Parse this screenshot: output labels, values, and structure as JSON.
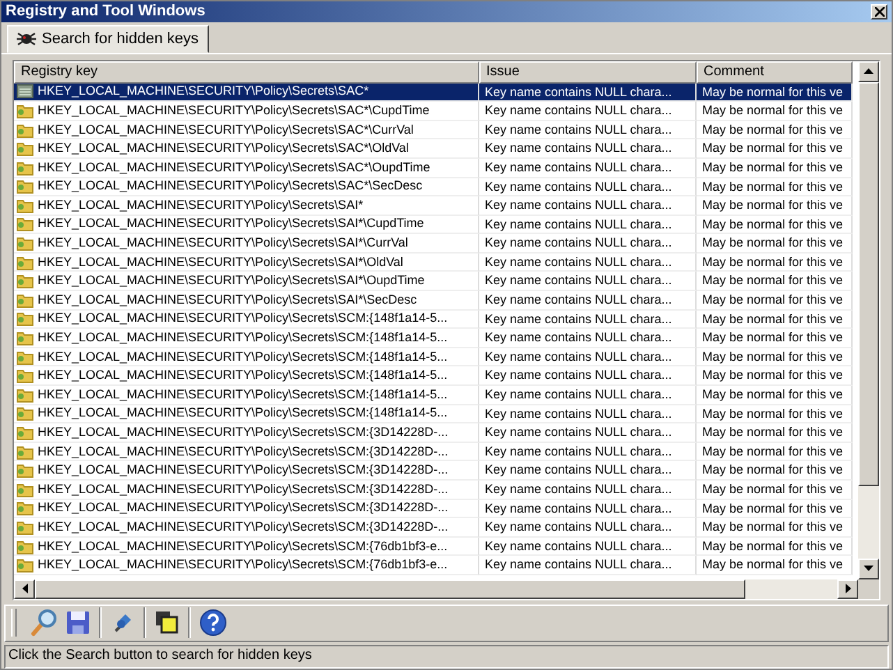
{
  "window": {
    "title": "Registry and Tool Windows"
  },
  "tabs": [
    {
      "label": "Search for hidden keys",
      "selected": true
    }
  ],
  "table": {
    "columns": [
      "Registry key",
      "Issue",
      "Comment"
    ],
    "rows": [
      {
        "key": "HKEY_LOCAL_MACHINE\\SECURITY\\Policy\\Secrets\\SAC*",
        "issue": "Key name contains NULL chara...",
        "comment": "May be normal for this ve",
        "selected": true
      },
      {
        "key": "HKEY_LOCAL_MACHINE\\SECURITY\\Policy\\Secrets\\SAC*\\CupdTime",
        "issue": "Key name contains NULL chara...",
        "comment": "May be normal for this ve",
        "selected": false
      },
      {
        "key": "HKEY_LOCAL_MACHINE\\SECURITY\\Policy\\Secrets\\SAC*\\CurrVal",
        "issue": "Key name contains NULL chara...",
        "comment": "May be normal for this ve",
        "selected": false
      },
      {
        "key": "HKEY_LOCAL_MACHINE\\SECURITY\\Policy\\Secrets\\SAC*\\OldVal",
        "issue": "Key name contains NULL chara...",
        "comment": "May be normal for this ve",
        "selected": false
      },
      {
        "key": "HKEY_LOCAL_MACHINE\\SECURITY\\Policy\\Secrets\\SAC*\\OupdTime",
        "issue": "Key name contains NULL chara...",
        "comment": "May be normal for this ve",
        "selected": false
      },
      {
        "key": "HKEY_LOCAL_MACHINE\\SECURITY\\Policy\\Secrets\\SAC*\\SecDesc",
        "issue": "Key name contains NULL chara...",
        "comment": "May be normal for this ve",
        "selected": false
      },
      {
        "key": "HKEY_LOCAL_MACHINE\\SECURITY\\Policy\\Secrets\\SAI*",
        "issue": "Key name contains NULL chara...",
        "comment": "May be normal for this ve",
        "selected": false
      },
      {
        "key": "HKEY_LOCAL_MACHINE\\SECURITY\\Policy\\Secrets\\SAI*\\CupdTime",
        "issue": "Key name contains NULL chara...",
        "comment": "May be normal for this ve",
        "selected": false
      },
      {
        "key": "HKEY_LOCAL_MACHINE\\SECURITY\\Policy\\Secrets\\SAI*\\CurrVal",
        "issue": "Key name contains NULL chara...",
        "comment": "May be normal for this ve",
        "selected": false
      },
      {
        "key": "HKEY_LOCAL_MACHINE\\SECURITY\\Policy\\Secrets\\SAI*\\OldVal",
        "issue": "Key name contains NULL chara...",
        "comment": "May be normal for this ve",
        "selected": false
      },
      {
        "key": "HKEY_LOCAL_MACHINE\\SECURITY\\Policy\\Secrets\\SAI*\\OupdTime",
        "issue": "Key name contains NULL chara...",
        "comment": "May be normal for this ve",
        "selected": false
      },
      {
        "key": "HKEY_LOCAL_MACHINE\\SECURITY\\Policy\\Secrets\\SAI*\\SecDesc",
        "issue": "Key name contains NULL chara...",
        "comment": "May be normal for this ve",
        "selected": false
      },
      {
        "key": "HKEY_LOCAL_MACHINE\\SECURITY\\Policy\\Secrets\\SCM:{148f1a14-5...",
        "issue": "Key name contains NULL chara...",
        "comment": "May be normal for this ve",
        "selected": false
      },
      {
        "key": "HKEY_LOCAL_MACHINE\\SECURITY\\Policy\\Secrets\\SCM:{148f1a14-5...",
        "issue": "Key name contains NULL chara...",
        "comment": "May be normal for this ve",
        "selected": false
      },
      {
        "key": "HKEY_LOCAL_MACHINE\\SECURITY\\Policy\\Secrets\\SCM:{148f1a14-5...",
        "issue": "Key name contains NULL chara...",
        "comment": "May be normal for this ve",
        "selected": false
      },
      {
        "key": "HKEY_LOCAL_MACHINE\\SECURITY\\Policy\\Secrets\\SCM:{148f1a14-5...",
        "issue": "Key name contains NULL chara...",
        "comment": "May be normal for this ve",
        "selected": false
      },
      {
        "key": "HKEY_LOCAL_MACHINE\\SECURITY\\Policy\\Secrets\\SCM:{148f1a14-5...",
        "issue": "Key name contains NULL chara...",
        "comment": "May be normal for this ve",
        "selected": false
      },
      {
        "key": "HKEY_LOCAL_MACHINE\\SECURITY\\Policy\\Secrets\\SCM:{148f1a14-5...",
        "issue": "Key name contains NULL chara...",
        "comment": "May be normal for this ve",
        "selected": false
      },
      {
        "key": "HKEY_LOCAL_MACHINE\\SECURITY\\Policy\\Secrets\\SCM:{3D14228D-...",
        "issue": "Key name contains NULL chara...",
        "comment": "May be normal for this ve",
        "selected": false
      },
      {
        "key": "HKEY_LOCAL_MACHINE\\SECURITY\\Policy\\Secrets\\SCM:{3D14228D-...",
        "issue": "Key name contains NULL chara...",
        "comment": "May be normal for this ve",
        "selected": false
      },
      {
        "key": "HKEY_LOCAL_MACHINE\\SECURITY\\Policy\\Secrets\\SCM:{3D14228D-...",
        "issue": "Key name contains NULL chara...",
        "comment": "May be normal for this ve",
        "selected": false
      },
      {
        "key": "HKEY_LOCAL_MACHINE\\SECURITY\\Policy\\Secrets\\SCM:{3D14228D-...",
        "issue": "Key name contains NULL chara...",
        "comment": "May be normal for this ve",
        "selected": false
      },
      {
        "key": "HKEY_LOCAL_MACHINE\\SECURITY\\Policy\\Secrets\\SCM:{3D14228D-...",
        "issue": "Key name contains NULL chara...",
        "comment": "May be normal for this ve",
        "selected": false
      },
      {
        "key": "HKEY_LOCAL_MACHINE\\SECURITY\\Policy\\Secrets\\SCM:{3D14228D-...",
        "issue": "Key name contains NULL chara...",
        "comment": "May be normal for this ve",
        "selected": false
      },
      {
        "key": "HKEY_LOCAL_MACHINE\\SECURITY\\Policy\\Secrets\\SCM:{76db1bf3-e...",
        "issue": "Key name contains NULL chara...",
        "comment": "May be normal for this ve",
        "selected": false
      },
      {
        "key": "HKEY_LOCAL_MACHINE\\SECURITY\\Policy\\Secrets\\SCM:{76db1bf3-e...",
        "issue": "Key name contains NULL chara...",
        "comment": "May be normal for this ve",
        "selected": false
      }
    ]
  },
  "toolbar": [
    {
      "kind": "search"
    },
    {
      "kind": "save"
    },
    {
      "kind": "pin"
    },
    {
      "kind": "windows"
    },
    {
      "kind": "help"
    }
  ],
  "status_bar": "Click the Search button to search for hidden keys"
}
